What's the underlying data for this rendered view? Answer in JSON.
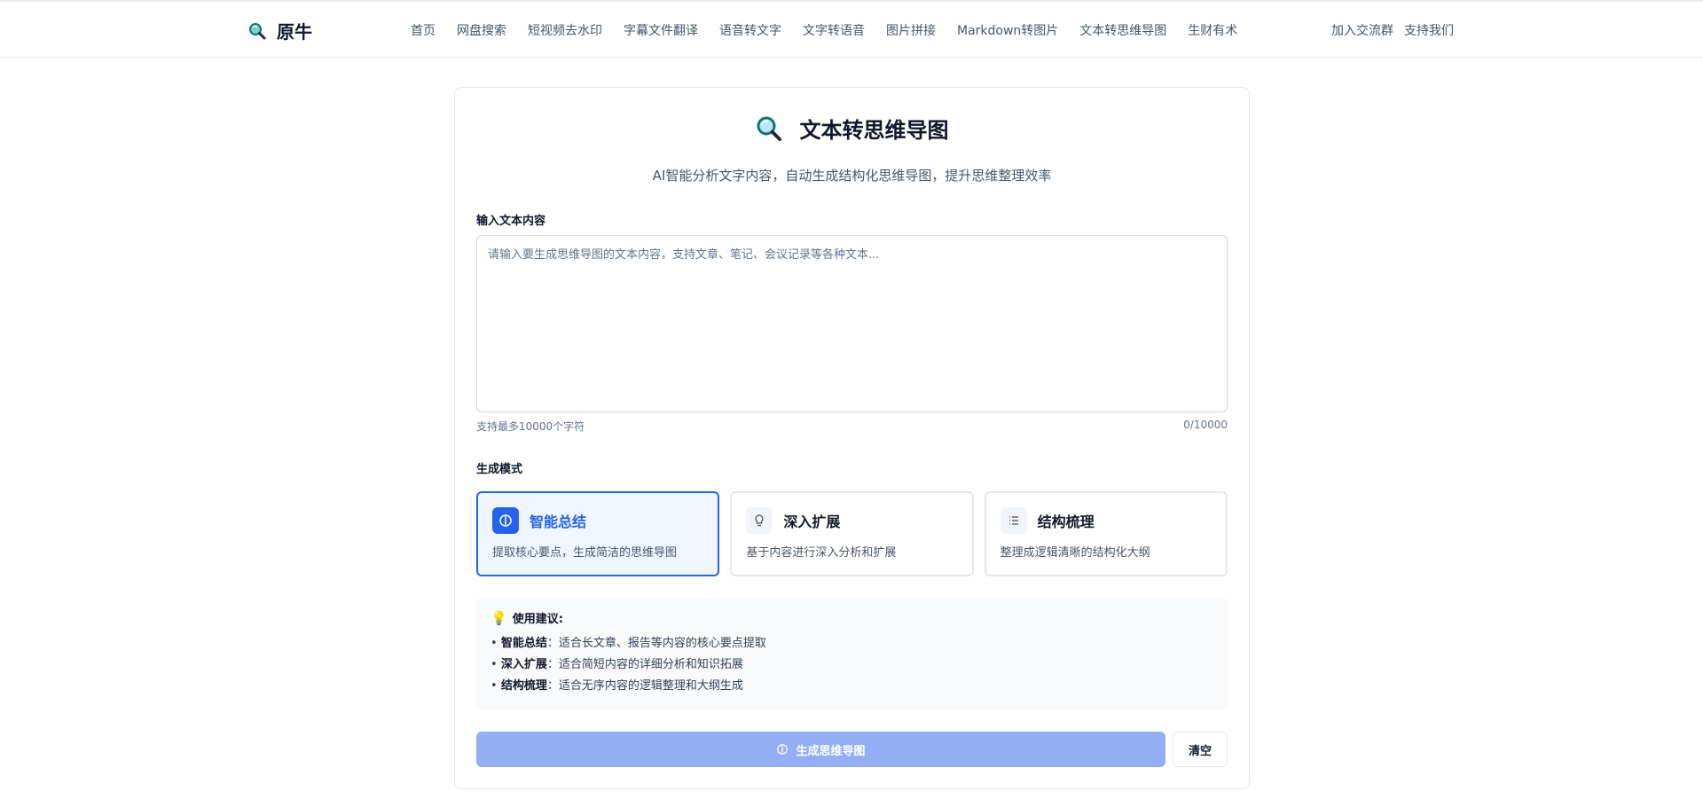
{
  "header": {
    "brand": "原牛",
    "nav": [
      "首页",
      "网盘搜索",
      "短视频去水印",
      "字幕文件翻译",
      "语音转文字",
      "文字转语音",
      "图片拼接",
      "Markdown转图片",
      "文本转思维导图",
      "生财有术"
    ],
    "right_links": [
      "加入交流群",
      "支持我们"
    ]
  },
  "main": {
    "title": "文本转思维导图",
    "subtitle": "AI智能分析文字内容，自动生成结构化思维导图，提升思维整理效率",
    "input_label": "输入文本内容",
    "input_placeholder": "请输入要生成思维导图的文本内容，支持文章、笔记、会议记录等各种文本...",
    "input_value": "",
    "char_limit_hint": "支持最多10000个字符",
    "char_count": "0/10000",
    "mode_label": "生成模式",
    "modes": [
      {
        "title": "智能总结",
        "desc": "提取核心要点，生成简洁的思维导图",
        "icon": "brain-icon",
        "active": true
      },
      {
        "title": "深入扩展",
        "desc": "基于内容进行深入分析和扩展",
        "icon": "lightbulb-icon",
        "active": false
      },
      {
        "title": "结构梳理",
        "desc": "整理成逻辑清晰的结构化大纲",
        "icon": "list-icon",
        "active": false
      }
    ],
    "tips": {
      "heading": "使用建议:",
      "items": [
        {
          "term": "智能总结",
          "text": "：适合长文章、报告等内容的核心要点提取"
        },
        {
          "term": "深入扩展",
          "text": "：适合简短内容的详细分析和知识拓展"
        },
        {
          "term": "结构梳理",
          "text": "：适合无序内容的逻辑整理和大纲生成"
        }
      ]
    },
    "generate_label": "生成思维导图",
    "clear_label": "清空"
  },
  "colors": {
    "accent": "#2563eb",
    "accent_light": "#eff6ff",
    "disabled_button": "#93aef5",
    "text_muted": "#475569"
  }
}
